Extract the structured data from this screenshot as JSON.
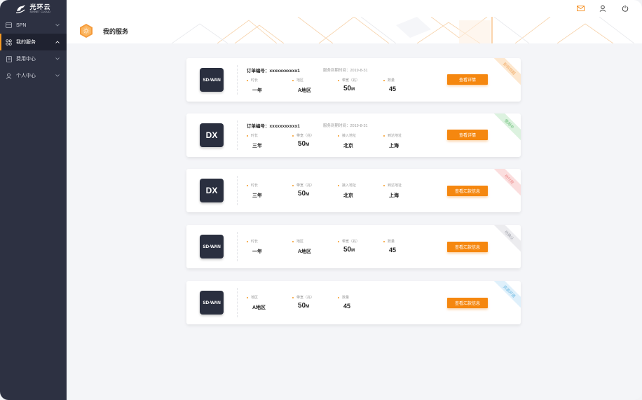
{
  "logo": {
    "cn": "光环云",
    "en": "SINNET CLOUD"
  },
  "sidebar": {
    "items": [
      {
        "label": "SPN"
      },
      {
        "label": "我的服务"
      },
      {
        "label": "费用中心"
      },
      {
        "label": "个人中心"
      }
    ]
  },
  "header": {
    "icons": [
      "mail-icon",
      "user-icon",
      "power-icon"
    ]
  },
  "page": {
    "title": "我的服务"
  },
  "colors": {
    "accent": "#f5870f",
    "sidebar": "#2d3142",
    "product_tile": "#2a2f3f"
  },
  "cards": [
    {
      "product": "SD-WAN",
      "order_no": "订单编号：xxxxxxxxxxx1",
      "expire": "服务到期时间：2019-8-31",
      "fields": [
        {
          "label": "时长",
          "value": "一年"
        },
        {
          "label": "地区",
          "value": "A地区"
        },
        {
          "label": "带宽（兆）",
          "value": "50",
          "unit": "M"
        },
        {
          "label": "数量",
          "value": "45"
        }
      ],
      "button": "查看详情",
      "status": "即将到期",
      "status_color": "#f8c487"
    },
    {
      "product": "DX",
      "order_no": "订单编号：xxxxxxxxxxx1",
      "expire": "服务到期时间：2019-8-31",
      "fields": [
        {
          "label": "时长",
          "value": "三年"
        },
        {
          "label": "带宽（兆）",
          "value": "50",
          "unit": "M"
        },
        {
          "label": "接入地址",
          "value": "北京"
        },
        {
          "label": "到达地址",
          "value": "上海"
        }
      ],
      "button": "查看详情",
      "status": "使用中",
      "status_color": "#8fd59a"
    },
    {
      "product": "DX",
      "fields": [
        {
          "label": "时长",
          "value": "三年"
        },
        {
          "label": "带宽（兆）",
          "value": "50",
          "unit": "M"
        },
        {
          "label": "接入地址",
          "value": "北京"
        },
        {
          "label": "到达地址",
          "value": "上海"
        }
      ],
      "button": "查看汇款信息",
      "status": "待付款",
      "status_color": "#f5a3a3"
    },
    {
      "product": "SD-WAN",
      "fields": [
        {
          "label": "时长",
          "value": "一年"
        },
        {
          "label": "地区",
          "value": "A地区"
        },
        {
          "label": "带宽（兆）",
          "value": "50",
          "unit": "M"
        },
        {
          "label": "数量",
          "value": "45"
        }
      ],
      "button": "查看汇款信息",
      "status": "待确认",
      "status_color": "#c8c9ce"
    },
    {
      "product": "SD-WAN",
      "fields": [
        {
          "label": "地区",
          "value": "A地区"
        },
        {
          "label": "带宽（兆）",
          "value": "50",
          "unit": "M"
        },
        {
          "label": "数量",
          "value": "45"
        }
      ],
      "button": "查看汇款信息",
      "status": "资源开通",
      "status_color": "#9fd3f0"
    }
  ]
}
